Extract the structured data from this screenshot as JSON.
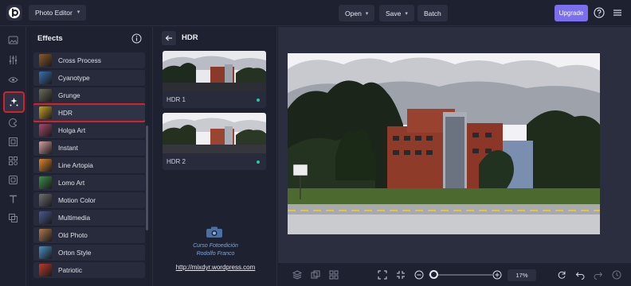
{
  "topbar": {
    "app_name": "Photo Editor",
    "open_label": "Open",
    "save_label": "Save",
    "batch_label": "Batch",
    "upgrade_label": "Upgrade",
    "accent_color": "#7b6ff0"
  },
  "rail": {
    "icons": [
      "image-icon",
      "sliders-icon",
      "eye-icon",
      "effects-icon",
      "paint-icon",
      "frame-icon",
      "shapes-icon",
      "texture-icon",
      "text-icon",
      "layers-icon"
    ],
    "active": "effects-icon"
  },
  "effects": {
    "title": "Effects",
    "items": [
      {
        "label": "Cross Process",
        "color": "#8b5a2b"
      },
      {
        "label": "Cyanotype",
        "color": "#3a6fb0"
      },
      {
        "label": "Grunge",
        "color": "#6b6b5a"
      },
      {
        "label": "HDR",
        "color": "#c9a227"
      },
      {
        "label": "Holga Art",
        "color": "#a84a6a"
      },
      {
        "label": "Instant",
        "color": "#d8a0a0"
      },
      {
        "label": "Line Artopia",
        "color": "#e0862a"
      },
      {
        "label": "Lomo Art",
        "color": "#3f8f4a"
      },
      {
        "label": "Motion Color",
        "color": "#707070"
      },
      {
        "label": "Multimedia",
        "color": "#4c5a8c"
      },
      {
        "label": "Old Photo",
        "color": "#b07a4a"
      },
      {
        "label": "Orton Style",
        "color": "#4a8fc4"
      },
      {
        "label": "Patriotic",
        "color": "#c0392b"
      }
    ],
    "selected": "HDR"
  },
  "hdr_panel": {
    "title": "HDR",
    "presets": [
      {
        "label": "HDR 1"
      },
      {
        "label": "HDR 2"
      }
    ],
    "status_color": "#2fc4a4"
  },
  "watermark": {
    "line1": "Curso Fotoedición",
    "line2": "Rodolfo Franco",
    "url": "http://mixdyr.wordpress.com"
  },
  "bottombar": {
    "zoom_value": "17%",
    "zoom_fraction": 0.17
  }
}
